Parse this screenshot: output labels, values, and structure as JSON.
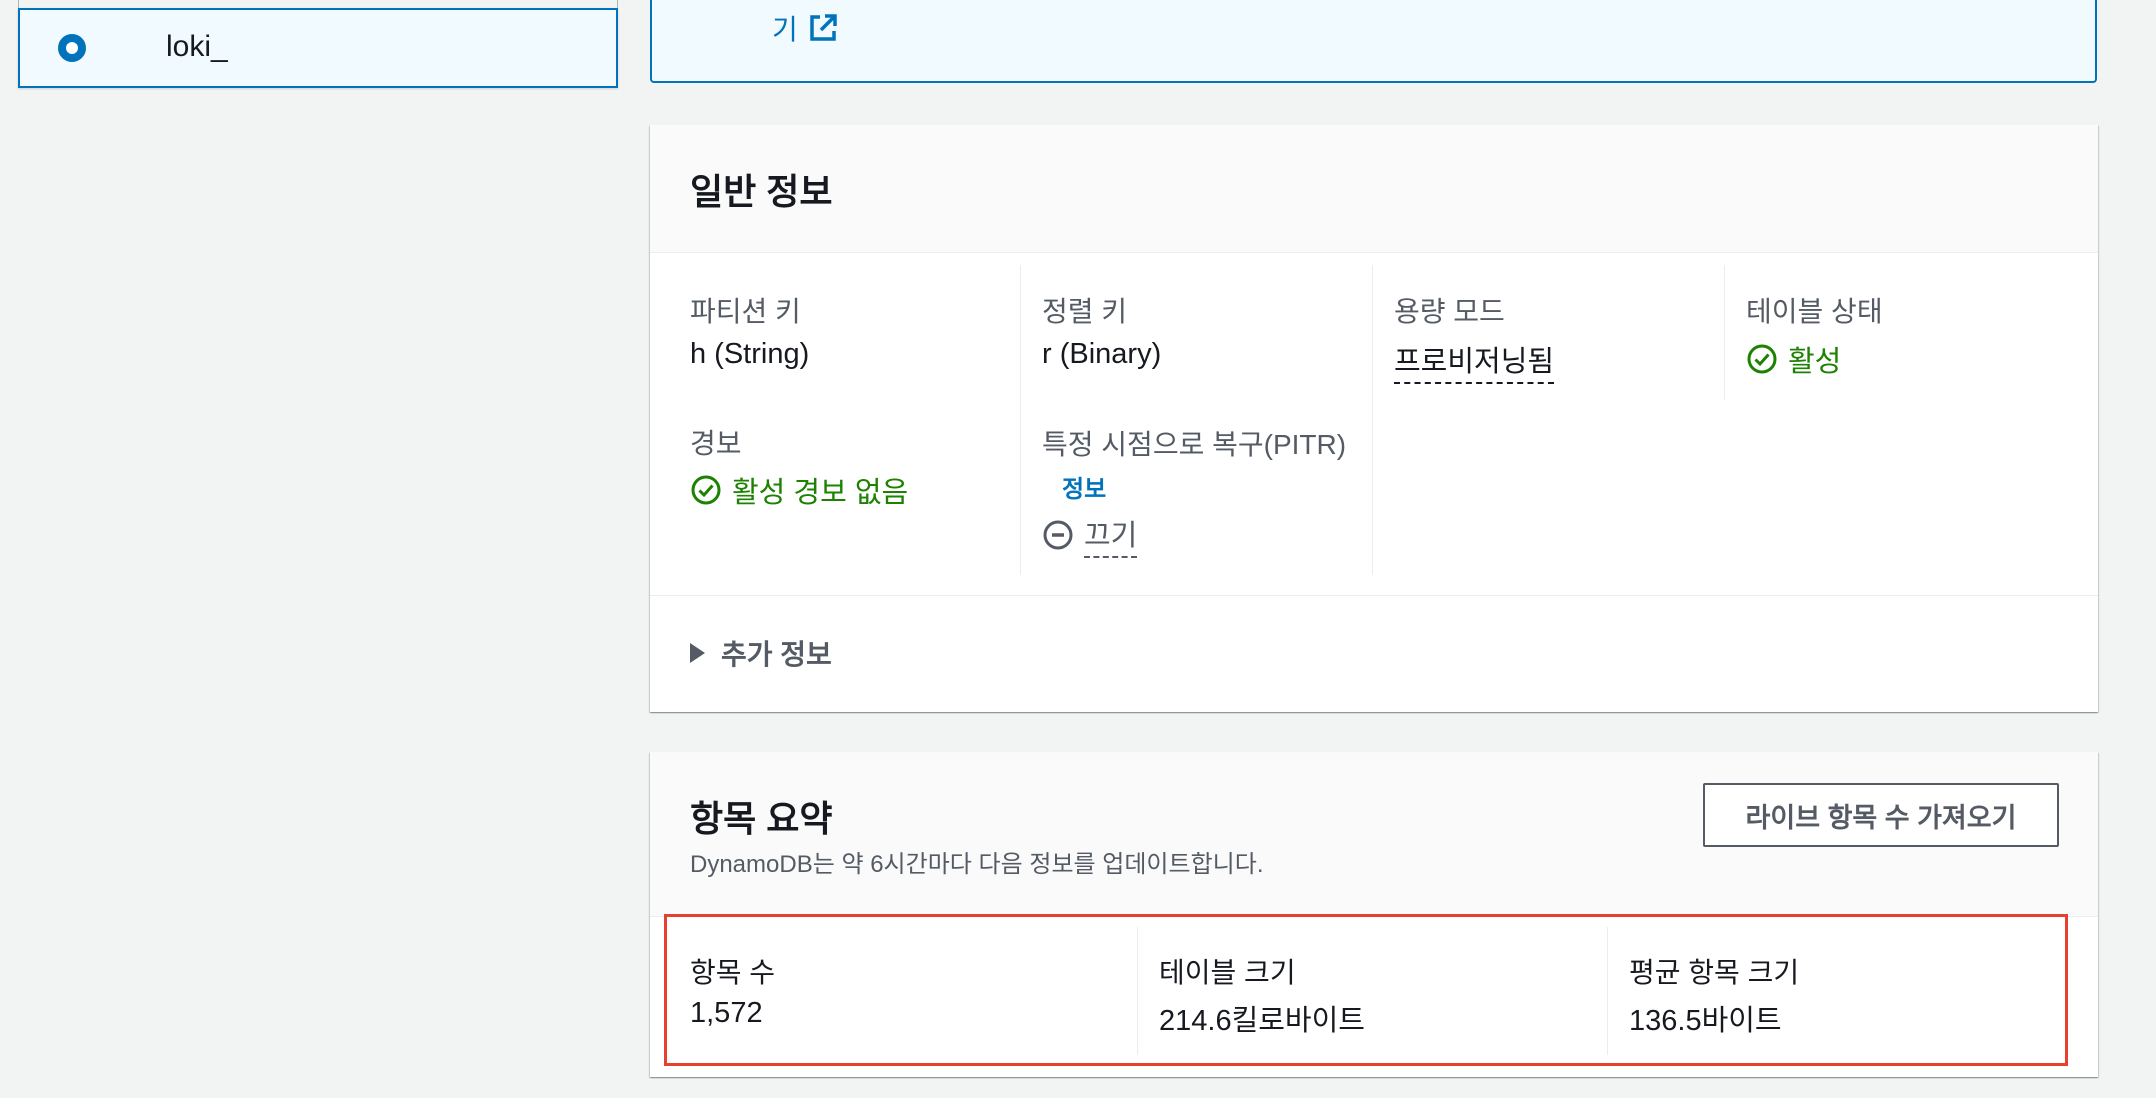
{
  "sidebar": {
    "selected_table": "loki_"
  },
  "top_box": {
    "link_text": "기"
  },
  "general": {
    "title": "일반 정보",
    "partition_key": {
      "label": "파티션 키",
      "value": "h (String)"
    },
    "sort_key": {
      "label": "정렬 키",
      "value": "r (Binary)"
    },
    "capacity_mode": {
      "label": "용량 모드",
      "value": "프로비저닝됨"
    },
    "table_status": {
      "label": "테이블 상태",
      "value": "활성"
    },
    "alarms": {
      "label": "경보",
      "value": "활성 경보 없음"
    },
    "pitr": {
      "label": "특정 시점으로 복구(PITR)",
      "info": "정보",
      "value": "끄기"
    },
    "additional_info": "추가 정보"
  },
  "summary": {
    "title": "항목 요약",
    "description": "DynamoDB는 약 6시간마다 다음 정보를 업데이트합니다.",
    "live_button": "라이브 항목 수 가져오기",
    "item_count": {
      "label": "항목 수",
      "value": "1,572"
    },
    "table_size": {
      "label": "테이블 크기",
      "value": "214.6킬로바이트"
    },
    "avg_item_size": {
      "label": "평균 항목 크기",
      "value": "136.5바이트"
    }
  },
  "colors": {
    "link": "#0073bb",
    "success": "#1d8102",
    "highlight": "#e8402e"
  }
}
